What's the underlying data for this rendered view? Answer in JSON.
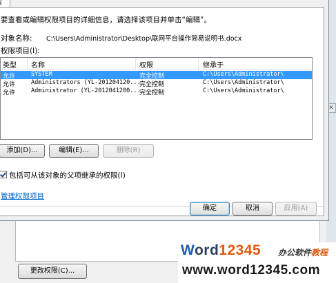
{
  "dialog": {
    "tab_stub": "限",
    "instruction": "要查看或编辑权限项目的详细信息，请选择该项目并单击“编辑”。",
    "object_label": "对象名称:",
    "object_path": "C:\\Users\\Administrator\\Desktop\\联网平台操作简易说明书.docx",
    "permissions_label": "权限项目(I):",
    "columns": [
      "类型",
      "名称",
      "权限",
      "继承于"
    ],
    "rows": [
      {
        "type": "允许",
        "name": "SYSTEM",
        "permission": "完全控制",
        "inherited": "C:\\Users\\Administrator\\"
      },
      {
        "type": "允许",
        "name": "Administrators (YL-201204120...",
        "permission": "完全控制",
        "inherited": "C:\\Users\\Administrator\\"
      },
      {
        "type": "允许",
        "name": "Administrator (YL-2012041200...",
        "permission": "完全控制",
        "inherited": "C:\\Users\\Administrator\\"
      }
    ],
    "add_label": "添加(D)...",
    "edit_label": "编辑(E)...",
    "delete_label": "删除(R)",
    "inherit_checkbox_label": "包括可从该对象的父项继承的权限(I)",
    "manage_link": "管理权限项目",
    "ok_label": "确定",
    "cancel_label": "取消",
    "apply_label": "应用(A)"
  },
  "background": {
    "change_perm_label": "更改权限(C)...",
    "close_glyph": "✕"
  },
  "watermark": {
    "logo_w": "W",
    "logo_ord": "ord",
    "logo_num": "12345",
    "cn_a": "办公软件",
    "cn_b": "教程",
    "url": "www.word12345.com"
  },
  "colors": {
    "selection": "#3399ff",
    "link": "#0066cc",
    "logo_blue": "#1a5fb4",
    "logo_orange": "#e05a10"
  }
}
